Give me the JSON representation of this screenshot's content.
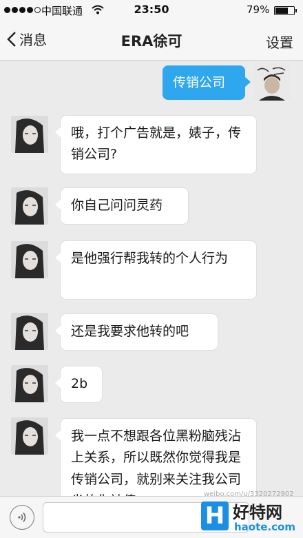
{
  "status_bar": {
    "carrier": "中国联通",
    "time": "23:50",
    "battery": "79%",
    "battery_level": 0.79
  },
  "nav": {
    "back_label": "消息",
    "title": "ERA徐可",
    "settings_label": "设置"
  },
  "messages": [
    {
      "from": "me",
      "text": "传销公司"
    },
    {
      "from": "other",
      "text": "哦，打个广告就是，婊子，传销公司?"
    },
    {
      "from": "other",
      "text": "你自己问问灵药"
    },
    {
      "from": "other",
      "text": "是他强行帮我转的个人行为"
    },
    {
      "from": "other",
      "text": "还是我要求他转的吧"
    },
    {
      "from": "other",
      "text": "2b"
    },
    {
      "from": "other",
      "text": "我一点不想跟各位黑粉脑残沾上关系，所以既然你觉得我是传销公司，就别来关注我公司 省的你被传"
    }
  ],
  "watermark": {
    "logo_letter": "H",
    "name": "好特网",
    "domain": "haote.com",
    "weibo": "weibo.com/u/3320272902"
  },
  "colors": {
    "my_bubble": "#2fa7ee",
    "brand": "#1b8fe3"
  }
}
